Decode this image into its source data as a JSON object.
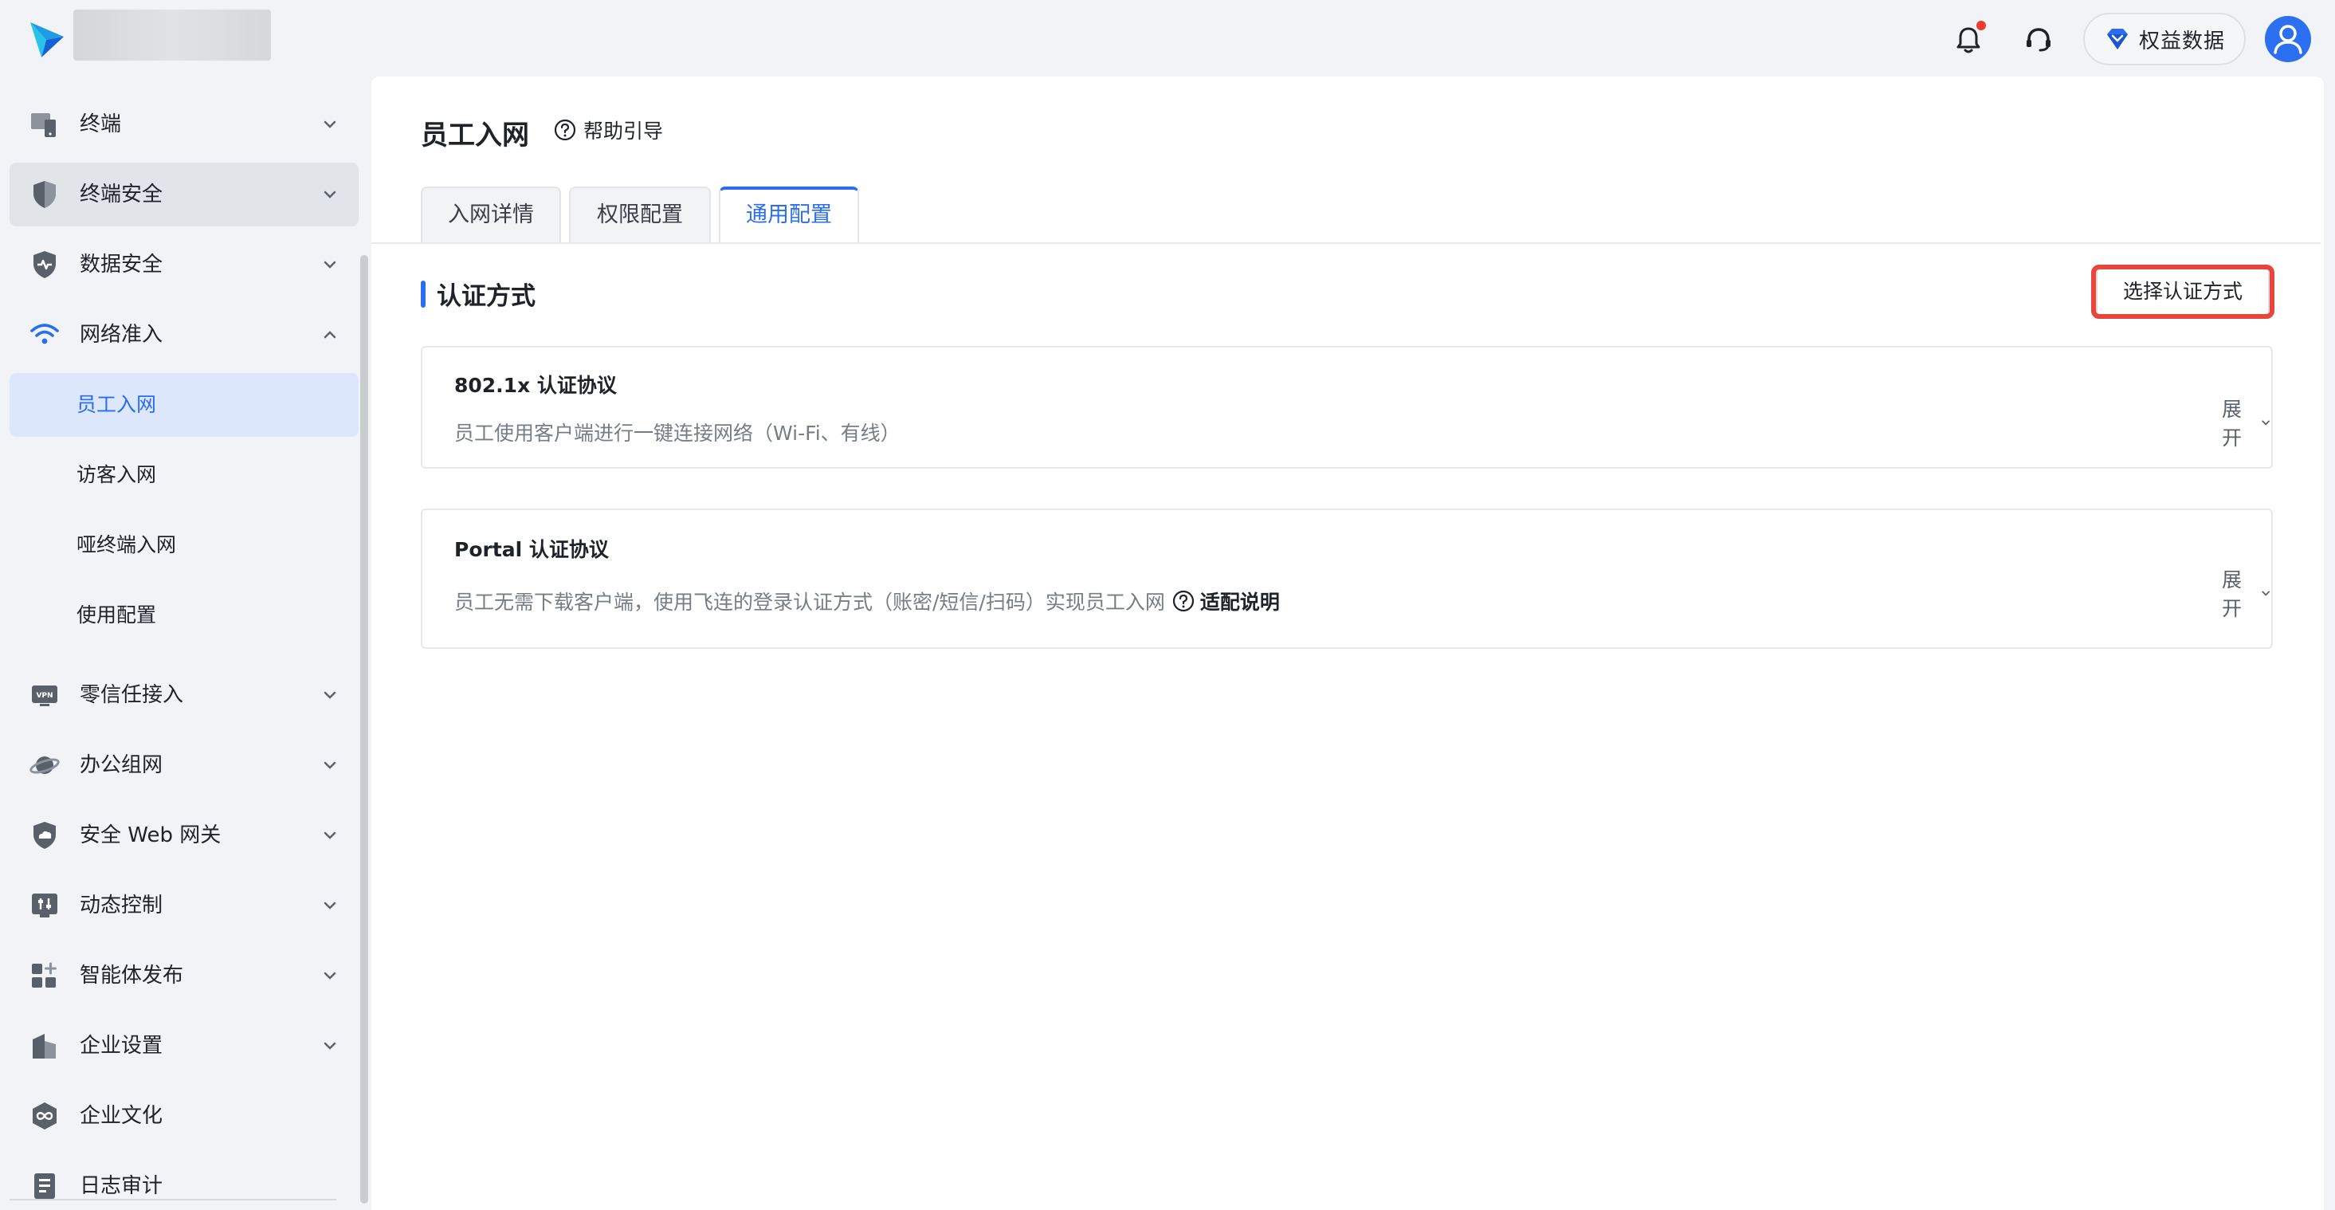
{
  "topbar": {
    "benefit_label": "权益数据",
    "has_notification": true
  },
  "sidebar": {
    "items": [
      {
        "label": "终端",
        "icon": "terminal-icon"
      },
      {
        "label": "终端安全",
        "icon": "shield-icon"
      },
      {
        "label": "数据安全",
        "icon": "data-shield-icon"
      },
      {
        "label": "网络准入",
        "icon": "wifi-icon"
      },
      {
        "label": "零信任接入",
        "icon": "vpn-icon"
      },
      {
        "label": "办公组网",
        "icon": "planet-icon"
      },
      {
        "label": "安全 Web 网关",
        "icon": "cloud-shield-icon"
      },
      {
        "label": "动态控制",
        "icon": "control-icon"
      },
      {
        "label": "智能体发布",
        "icon": "grid-plus-icon"
      },
      {
        "label": "企业设置",
        "icon": "building-icon"
      },
      {
        "label": "企业文化",
        "icon": "infinity-icon"
      },
      {
        "label": "日志审计",
        "icon": "log-icon"
      }
    ],
    "sub_items": [
      "员工入网",
      "访客入网",
      "哑终端入网",
      "使用配置"
    ],
    "active_sub": "员工入网"
  },
  "page": {
    "title": "员工入网",
    "help_label": "帮助引导"
  },
  "tabs": [
    "入网详情",
    "权限配置",
    "通用配置"
  ],
  "active_tab": "通用配置",
  "section": {
    "title": "认证方式",
    "select_button": "选择认证方式"
  },
  "cards": [
    {
      "title": "802.1x 认证协议",
      "desc": "员工使用客户端进行一键连接网络（Wi-Fi、有线）",
      "expand": "展开"
    },
    {
      "title": "Portal 认证协议",
      "desc": "员工无需下载客户端，使用飞连的登录认证方式（账密/短信/扫码）实现员工入网",
      "link": "适配说明",
      "expand": "展开"
    }
  ],
  "colors": {
    "accent": "#2b6df0",
    "highlight": "#e8453c",
    "notification": "#ee3b31"
  }
}
